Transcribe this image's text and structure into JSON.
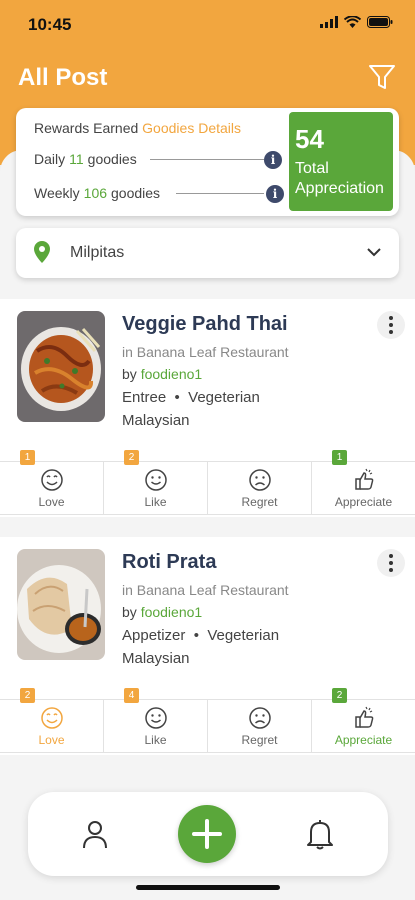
{
  "status_bar": {
    "time": "10:45"
  },
  "header": {
    "title": "All Post"
  },
  "rewards": {
    "title": "Rewards Earned",
    "details_link": "Goodies Details",
    "daily_label": "Daily",
    "daily_count": "11",
    "weekly_label": "Weekly",
    "weekly_count": "106",
    "unit": "goodies",
    "total_value": "54",
    "total_label_1": "Total",
    "total_label_2": "Appreciation"
  },
  "location": {
    "value": "Milpitas"
  },
  "posts": [
    {
      "title": "Veggie Pahd Thai",
      "restaurant": "in Banana Leaf Restaurant",
      "by": "by",
      "user": "foodieno1",
      "category": "Entree",
      "diet": "Vegeterian",
      "cuisine": "Malaysian",
      "reactions": [
        {
          "label": "Love",
          "count": "1"
        },
        {
          "label": "Like",
          "count": "2"
        },
        {
          "label": "Regret",
          "count": ""
        },
        {
          "label": "Appreciate",
          "count": "1"
        }
      ]
    },
    {
      "title": "Roti Prata",
      "restaurant": "in Banana Leaf Restaurant",
      "by": "by",
      "user": "foodieno1",
      "category": "Appetizer",
      "diet": "Vegeterian",
      "cuisine": "Malaysian",
      "reactions": [
        {
          "label": "Love",
          "count": "2"
        },
        {
          "label": "Like",
          "count": "4"
        },
        {
          "label": "Regret",
          "count": ""
        },
        {
          "label": "Appreciate",
          "count": "2"
        }
      ]
    }
  ],
  "icons": {
    "filter": "filter-icon",
    "location": "location-pin-icon",
    "dropdown": "chevron-down-icon",
    "profile": "user-icon",
    "add": "plus-icon",
    "notifications": "bell-icon"
  },
  "colors": {
    "brand_orange": "#f2a63f",
    "brand_green": "#5aa73a",
    "info_navy": "#3e4a6b"
  }
}
